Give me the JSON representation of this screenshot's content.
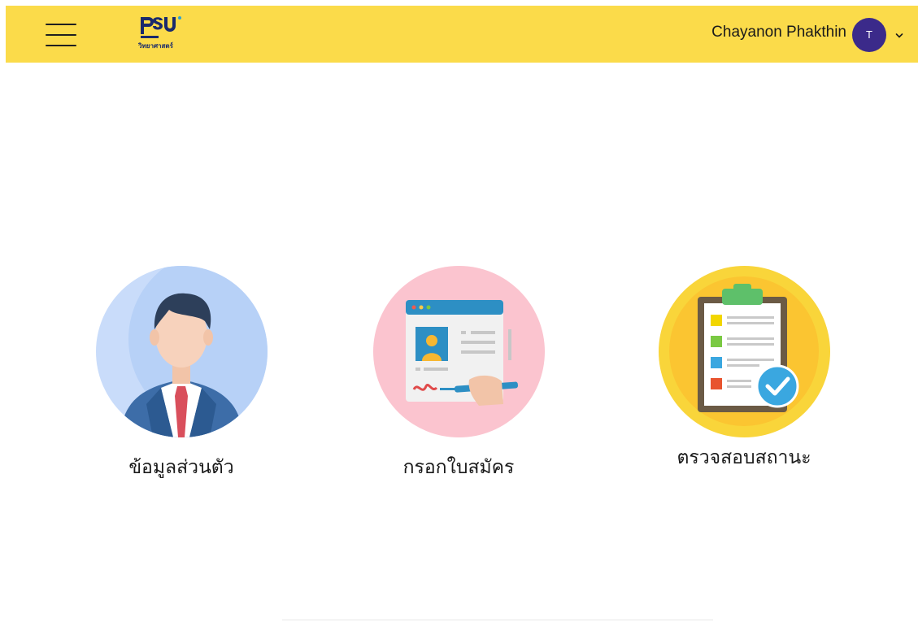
{
  "header": {
    "logo_sub": "วิทยาศาสตร์",
    "user_name": "Chayanon Phakthin",
    "avatar_initial": "T",
    "background": "#fbdb4a"
  },
  "tiles": [
    {
      "label": "ข้อมูลส่วนตัว",
      "icon": "businessman-icon",
      "circle_color": "#c9dcfa"
    },
    {
      "label": "กรอกใบสมัคร",
      "icon": "application-form-icon",
      "circle_color": "#fbc4cf"
    },
    {
      "label": "ตรวจสอบสถานะ",
      "icon": "checklist-clipboard-icon",
      "circle_color": "#f9d53a"
    }
  ]
}
